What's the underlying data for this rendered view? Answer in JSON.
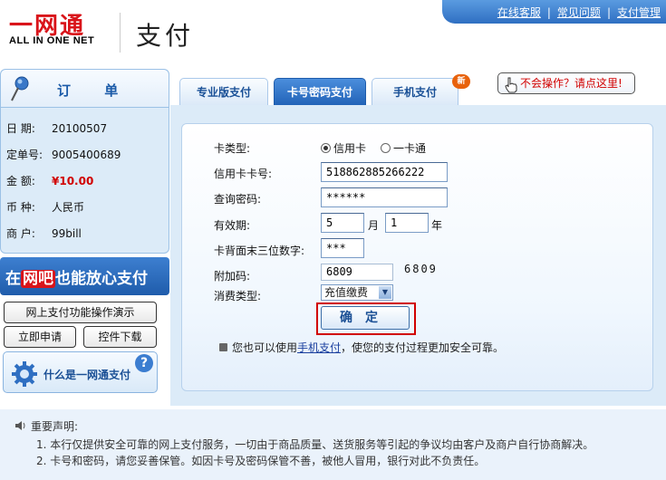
{
  "header": {
    "logo_main": "一网通",
    "logo_sub": "ALL IN ONE NET",
    "title": "支付",
    "links": [
      "在线客服",
      "常见问题",
      "支付管理"
    ]
  },
  "order": {
    "title": "订  单",
    "rows": [
      {
        "key": "日  期:",
        "value": "20100507"
      },
      {
        "key": "定单号:",
        "value": "9005400689"
      },
      {
        "key": "金  额:",
        "value": "¥10.00"
      },
      {
        "key": "币  种:",
        "value": "人民币"
      },
      {
        "key": "商  户:",
        "value": "99bill"
      }
    ]
  },
  "sidebar": {
    "banner_pre": "在",
    "banner_hl": "网吧",
    "banner_post": "也能放心支付",
    "btn_demo": "网上支付功能操作演示",
    "btn_apply": "立即申请",
    "btn_download": "控件下载",
    "whatis": "什么是一网通支付"
  },
  "tabs": [
    {
      "label": "专业版支付",
      "active": false
    },
    {
      "label": "卡号密码支付",
      "active": true
    },
    {
      "label": "手机支付",
      "active": false
    }
  ],
  "tab_badge": "新",
  "help_label": "不会操作？请点这里!",
  "form": {
    "card_type_label": "卡类型:",
    "card_type_options": [
      "信用卡",
      "一卡通"
    ],
    "card_number_label": "信用卡卡号:",
    "card_number_value": "518862885266222",
    "password_label": "查询密码:",
    "password_value": "******",
    "expiry_label": "有效期:",
    "expiry_month": "5",
    "month_unit": "月",
    "expiry_year": "1",
    "year_unit": "年",
    "cvv_label": "卡背面末三位数字:",
    "cvv_value": "***",
    "code_label": "附加码:",
    "code_value": "6809",
    "captcha_text": "6809",
    "consume_label": "消费类型:",
    "consume_value": "充值缴费",
    "confirm_label": "确定",
    "tip_pre": "您也可以使用",
    "tip_link": "手机支付",
    "tip_post": "，使您的支付过程更加安全可靠。"
  },
  "notice": {
    "title": "重要声明:",
    "items": [
      "1.  本行仅提供安全可靠的网上支付服务，一切由于商品质量、送货服务等引起的争议均由客户及商户自行协商解决。",
      "2.  卡号和密码，请您妥善保管。如因卡号及密码保管不善，被他人冒用，银行对此不负责任。"
    ]
  },
  "colors": {
    "brand_red": "#d9141a",
    "accent_blue": "#2263b8",
    "panel_bg": "#dcebf8"
  }
}
